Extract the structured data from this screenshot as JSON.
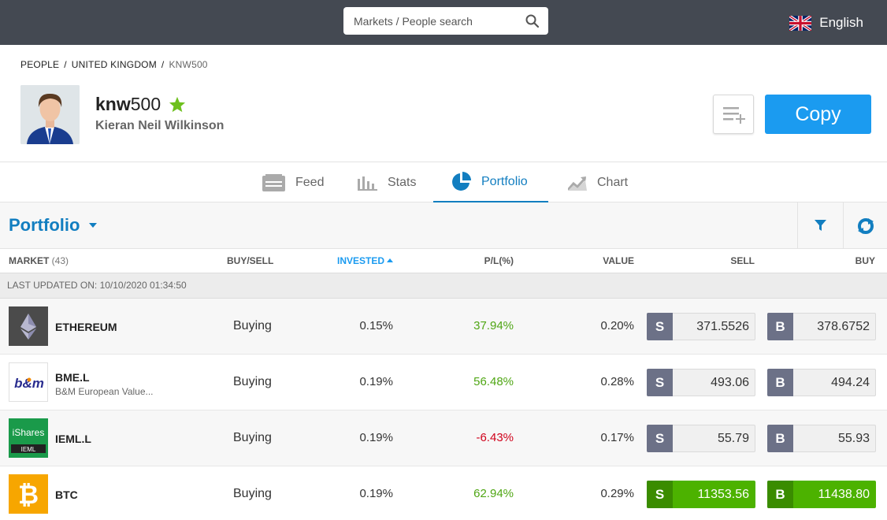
{
  "search": {
    "placeholder": "Markets / People search"
  },
  "language": {
    "label": "English"
  },
  "breadcrumb": {
    "items": [
      "PEOPLE",
      "UNITED KINGDOM",
      "KNW500"
    ]
  },
  "profile": {
    "username_bold": "knw",
    "username_rest": "500",
    "full_name": "Kieran Neil Wilkinson"
  },
  "actions": {
    "copy_label": "Copy"
  },
  "tabs": [
    {
      "label": "Feed"
    },
    {
      "label": "Stats"
    },
    {
      "label": "Portfolio"
    },
    {
      "label": "Chart"
    }
  ],
  "portfolio": {
    "title": "Portfolio"
  },
  "columns": {
    "market": "MARKET",
    "market_count": "(43)",
    "buysell": "BUY/SELL",
    "invested": "INVESTED",
    "pl": "P/L(%)",
    "value": "VALUE",
    "sell": "SELL",
    "buy": "BUY"
  },
  "last_updated": "LAST UPDATED ON: 10/10/2020 01:34:50",
  "price_tags": {
    "sell": "S",
    "buy": "B"
  },
  "logos": {
    "ishares_top": "iShares",
    "ishares_bottom": "IEML"
  },
  "rows": [
    {
      "name": "ETHEREUM",
      "subtitle": "",
      "action": "Buying",
      "invested": "0.15%",
      "pl": "37.94%",
      "value": "0.20%",
      "sell": "371.5526",
      "buy": "378.6752"
    },
    {
      "name": "BME.L",
      "subtitle": "B&M European Value...",
      "action": "Buying",
      "invested": "0.19%",
      "pl": "56.48%",
      "value": "0.28%",
      "sell": "493.06",
      "buy": "494.24"
    },
    {
      "name": "IEML.L",
      "subtitle": "",
      "action": "Buying",
      "invested": "0.19%",
      "pl": "-6.43%",
      "value": "0.17%",
      "sell": "55.79",
      "buy": "55.93"
    },
    {
      "name": "BTC",
      "subtitle": "",
      "action": "Buying",
      "invested": "0.19%",
      "pl": "62.94%",
      "value": "0.29%",
      "sell": "11353.56",
      "buy": "11438.80"
    }
  ],
  "colors": {
    "accent": "#127ec0",
    "copy_button": "#1b9bf0",
    "positive": "#4fa614",
    "negative": "#d0021b",
    "topbar": "#444952",
    "star": "#6ec01e"
  }
}
